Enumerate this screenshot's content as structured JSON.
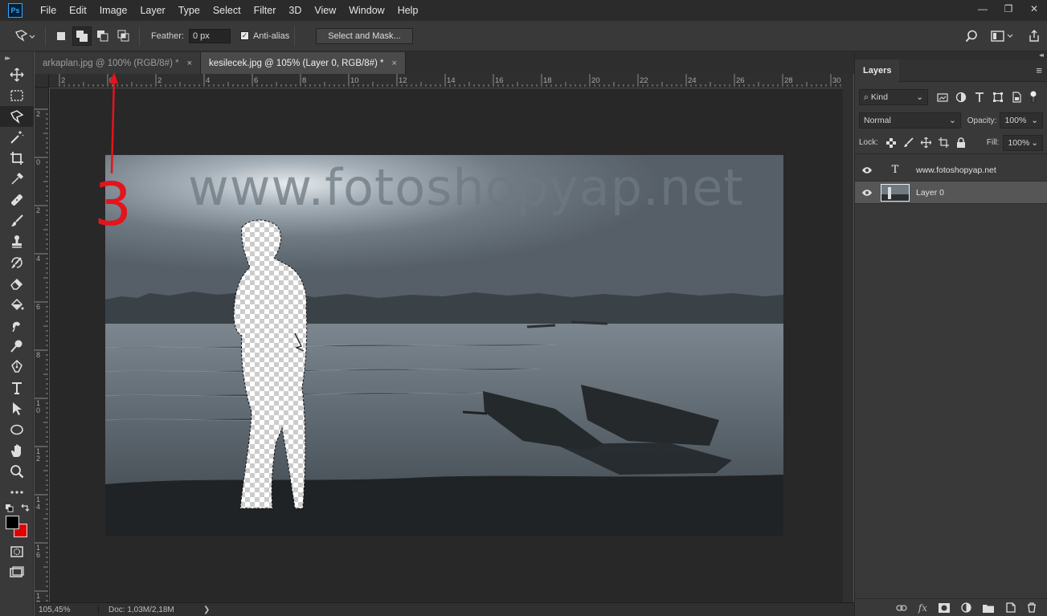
{
  "app": {
    "logo": "Ps"
  },
  "menu": [
    "File",
    "Edit",
    "Image",
    "Layer",
    "Type",
    "Select",
    "Filter",
    "3D",
    "View",
    "Window",
    "Help"
  ],
  "window_controls": [
    "—",
    "❐",
    "✕"
  ],
  "options": {
    "feather_label": "Feather:",
    "feather_value": "0 px",
    "anti_alias_label": "Anti-alias",
    "anti_alias_checked": true,
    "select_mask_label": "Select and Mask..."
  },
  "tabs": [
    {
      "label": "arkaplan.jpg @ 100% (RGB/8#) *",
      "active": false,
      "close": "×"
    },
    {
      "label": "kesilecek.jpg @ 105% (Layer 0, RGB/8#) *",
      "active": true,
      "close": "×"
    }
  ],
  "ruler_h_labels": [
    "2",
    "0",
    "2",
    "4",
    "6",
    "8",
    "10",
    "12",
    "14",
    "16",
    "18",
    "20",
    "22",
    "24",
    "26",
    "28",
    "30"
  ],
  "ruler_v_labels": [
    "2",
    "0",
    "2",
    "4",
    "6",
    "8",
    "1 0",
    "1 2",
    "1 4",
    "1 6",
    "1 8"
  ],
  "canvas": {
    "watermark": "www.fotoshopyap.net",
    "annotation_number": "3"
  },
  "status": {
    "zoom": "105,45%",
    "doc": "Doc: 1,03M/2,18M",
    "arrow": "❯"
  },
  "layers_panel": {
    "title": "Layers",
    "kind_label": "Kind",
    "blend_mode": "Normal",
    "opacity_label": "Opacity:",
    "opacity_value": "100%",
    "lock_label": "Lock:",
    "fill_label": "Fill:",
    "fill_value": "100%",
    "layers": [
      {
        "name": "www.fotoshopyap.net",
        "type": "text",
        "thumb": "T",
        "selected": false
      },
      {
        "name": "Layer 0",
        "type": "image",
        "thumb": "",
        "selected": true
      }
    ]
  },
  "colors": {
    "foreground": "#000000",
    "background": "#e10000",
    "annotation": "#e3141c"
  }
}
